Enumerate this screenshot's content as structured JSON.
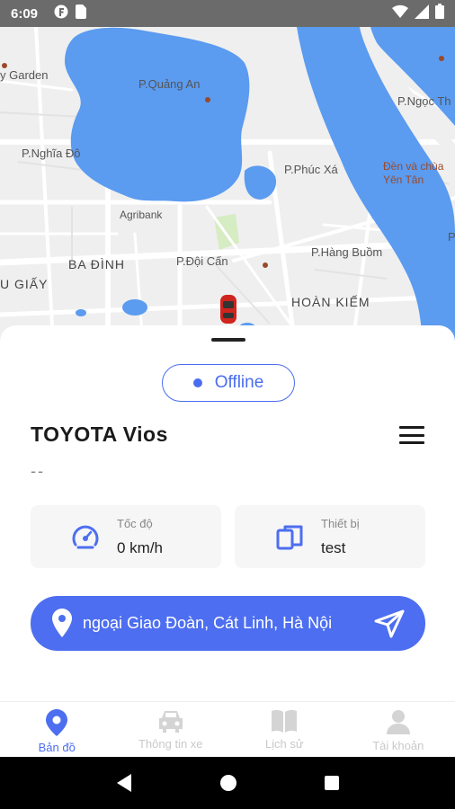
{
  "status_bar": {
    "time": "6:09",
    "left_icons": [
      "notification-f-icon",
      "sim-card-icon"
    ],
    "right_icons": [
      "wifi-icon",
      "signal-icon",
      "battery-icon"
    ]
  },
  "map": {
    "labels": {
      "garden": "y Garden",
      "quang_an": "P.Quảng An",
      "ngoc_tha": "P.Ngọc Th",
      "nghia_do": "P.Nghĩa Đô",
      "phuc_xa": "P.Phúc Xá",
      "temple": "Đền và chùa\nYên Tân",
      "agribank": "Agribank",
      "hang_buom": "P.Hàng Buồm",
      "ba_dinh": "BA ĐÌNH",
      "doi_can": "P.Đội Cấn",
      "cau_giay": "U GIẤY",
      "hoan_kiem": "HOÀN KIẾM",
      "p_edge": "P."
    },
    "colors": {
      "water": "#5b9bf0",
      "land": "#efefef",
      "road": "#ffffff",
      "park": "#d6ecc2"
    }
  },
  "sheet": {
    "status": "Offline",
    "vehicle_name": "TOYOTA Vios",
    "plate": "--",
    "speed": {
      "title": "Tốc độ",
      "value": "0 km/h",
      "icon": "speedometer-icon"
    },
    "device": {
      "title": "Thiết bị",
      "value": "test",
      "icon": "devices-icon"
    },
    "address": "ngoại Giao Đoàn, Cát Linh, Hà Nội"
  },
  "tabs": [
    {
      "label": "Bản đồ",
      "icon": "map-pin-icon",
      "active": true
    },
    {
      "label": "Thông tin xe",
      "icon": "car-icon",
      "active": false
    },
    {
      "label": "Lịch sử",
      "icon": "book-icon",
      "active": false
    },
    {
      "label": "Tài khoản",
      "icon": "person-icon",
      "active": false
    }
  ],
  "accent_color": "#4d6ef0"
}
